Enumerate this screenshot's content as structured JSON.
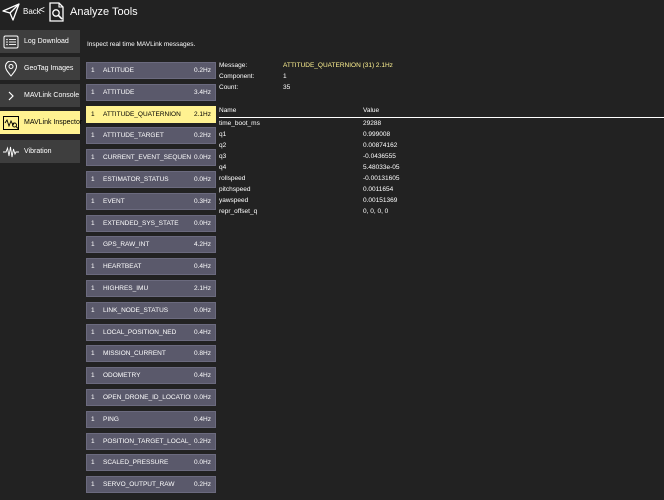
{
  "header": {
    "back_label": "Back",
    "back_chevron": "<",
    "title": "Analyze Tools",
    "icons": [
      "paper-plane-icon",
      "analyze-tools-icon"
    ]
  },
  "sidebar": {
    "items": [
      {
        "label": "Log Download",
        "icon": "log-list-icon",
        "active": false
      },
      {
        "label": "GeoTag Images",
        "icon": "map-pin-icon",
        "active": false
      },
      {
        "label": "MAVLink Console",
        "icon": "chevron-right-icon",
        "active": false
      },
      {
        "label": "MAVLink Inspector",
        "icon": "waveform-inspector-icon",
        "active": true
      },
      {
        "label": "Vibration",
        "icon": "vibration-wave-icon",
        "active": false
      }
    ]
  },
  "intro_text": "Inspect real time MAVLink messages.",
  "messages": [
    {
      "comp": "1",
      "name": "ALTITUDE",
      "rate": "0.2Hz"
    },
    {
      "comp": "1",
      "name": "ATTITUDE",
      "rate": "3.4Hz"
    },
    {
      "comp": "1",
      "name": "ATTITUDE_QUATERNION",
      "rate": "2.1Hz",
      "active": true
    },
    {
      "comp": "1",
      "name": "ATTITUDE_TARGET",
      "rate": "0.2Hz"
    },
    {
      "comp": "1",
      "name": "CURRENT_EVENT_SEQUENCE",
      "rate": "0.0Hz"
    },
    {
      "comp": "1",
      "name": "ESTIMATOR_STATUS",
      "rate": "0.0Hz"
    },
    {
      "comp": "1",
      "name": "EVENT",
      "rate": "0.3Hz"
    },
    {
      "comp": "1",
      "name": "EXTENDED_SYS_STATE",
      "rate": "0.0Hz"
    },
    {
      "comp": "1",
      "name": "GPS_RAW_INT",
      "rate": "4.2Hz"
    },
    {
      "comp": "1",
      "name": "HEARTBEAT",
      "rate": "0.4Hz"
    },
    {
      "comp": "1",
      "name": "HIGHRES_IMU",
      "rate": "2.1Hz"
    },
    {
      "comp": "1",
      "name": "LINK_NODE_STATUS",
      "rate": "0.0Hz"
    },
    {
      "comp": "1",
      "name": "LOCAL_POSITION_NED",
      "rate": "0.4Hz"
    },
    {
      "comp": "1",
      "name": "MISSION_CURRENT",
      "rate": "0.8Hz"
    },
    {
      "comp": "1",
      "name": "ODOMETRY",
      "rate": "0.4Hz"
    },
    {
      "comp": "1",
      "name": "OPEN_DRONE_ID_LOCATION",
      "rate": "0.0Hz"
    },
    {
      "comp": "1",
      "name": "PING",
      "rate": "0.4Hz"
    },
    {
      "comp": "1",
      "name": "POSITION_TARGET_LOCAL_NED",
      "rate": "0.2Hz"
    },
    {
      "comp": "1",
      "name": "SCALED_PRESSURE",
      "rate": "0.0Hz"
    },
    {
      "comp": "1",
      "name": "SERVO_OUTPUT_RAW",
      "rate": "0.2Hz"
    }
  ],
  "detail": {
    "message_label": "Message:",
    "message_value": "ATTITUDE_QUATERNION (31) 2.1Hz",
    "component_label": "Component:",
    "component_value": "1",
    "count_label": "Count:",
    "count_value": "35",
    "name_header": "Name",
    "value_header": "Value",
    "fields": [
      {
        "name": "time_boot_ms",
        "value": "29288"
      },
      {
        "name": "q1",
        "value": "0.999008"
      },
      {
        "name": "q2",
        "value": "0.00874162"
      },
      {
        "name": "q3",
        "value": "-0.0436555"
      },
      {
        "name": "q4",
        "value": "5.48033e-05"
      },
      {
        "name": "rollspeed",
        "value": "-0.00131605"
      },
      {
        "name": "pitchspeed",
        "value": "0.0011654"
      },
      {
        "name": "yawspeed",
        "value": "0.00151369"
      },
      {
        "name": "repr_offset_q",
        "value": "0, 0, 0, 0"
      }
    ]
  },
  "colors": {
    "background": "#222222",
    "sidebar_button": "#3e3e3e",
    "list_row": "#5a596b",
    "highlight": "#fff291"
  }
}
